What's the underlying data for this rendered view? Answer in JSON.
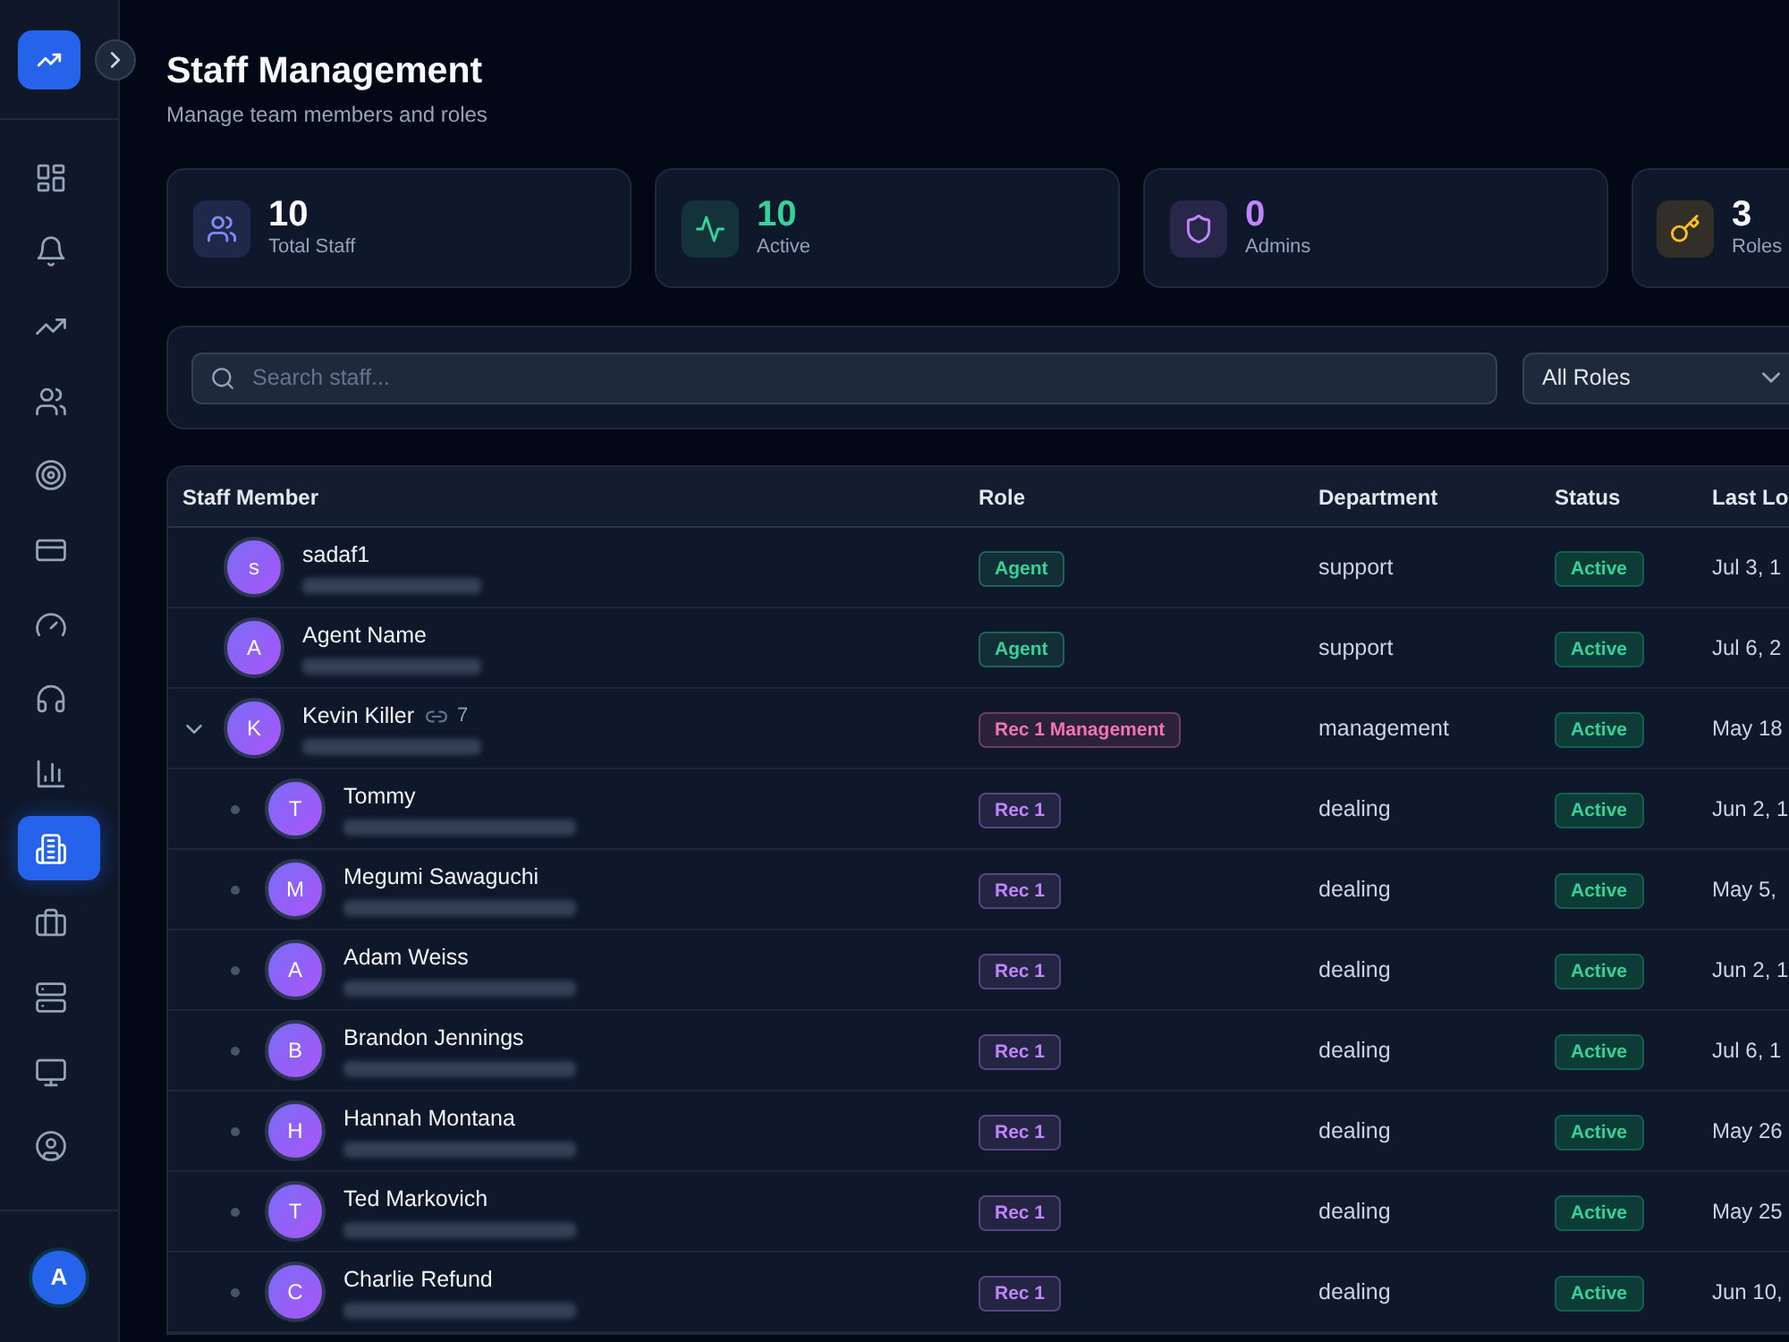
{
  "sidebar": {
    "items": [
      {
        "kind": "dashboard",
        "selected": false
      },
      {
        "kind": "bell",
        "selected": false
      },
      {
        "kind": "trending",
        "selected": false
      },
      {
        "kind": "users",
        "selected": false
      },
      {
        "kind": "target",
        "selected": false
      },
      {
        "kind": "card",
        "selected": false
      },
      {
        "kind": "gauge",
        "selected": false
      },
      {
        "kind": "headphones",
        "selected": false
      },
      {
        "kind": "chart",
        "selected": false
      },
      {
        "kind": "building",
        "selected": true
      },
      {
        "kind": "briefcase",
        "selected": false
      },
      {
        "kind": "server",
        "selected": false
      },
      {
        "kind": "monitor",
        "selected": false
      },
      {
        "kind": "profile",
        "selected": false
      }
    ],
    "user_avatar": "A"
  },
  "header": {
    "title": "Staff Management",
    "subtitle": "Manage team members and roles"
  },
  "stats": [
    {
      "kind": "staff",
      "value": "10",
      "label": "Total Staff",
      "color": "#818cf8",
      "highlight": false
    },
    {
      "kind": "activity",
      "value": "10",
      "label": "Active",
      "color": "#34d399",
      "highlight": true
    },
    {
      "kind": "admins",
      "value": "0",
      "label": "Admins",
      "color": "#c084fc",
      "highlight": true
    },
    {
      "kind": "roles",
      "value": "3",
      "label": "Roles",
      "color": "#fbbf24",
      "highlight": false
    }
  ],
  "filters": {
    "search": {
      "placeholder": "Search staff..."
    },
    "role_select": {
      "value": "All Roles"
    }
  },
  "table": {
    "columns": [
      "Staff Member",
      "Role",
      "Department",
      "Status",
      "Last Lo"
    ],
    "rows": [
      {
        "initial": "s",
        "name": "sadaf1",
        "email_blurred": true,
        "role": {
          "label": "Agent",
          "color": "#34d399"
        },
        "department": "support",
        "status": "Active",
        "last_login": "Jul 3, 1"
      },
      {
        "initial": "A",
        "name": "Agent Name",
        "email_blurred": true,
        "role": {
          "label": "Agent",
          "color": "#34d399"
        },
        "department": "support",
        "status": "Active",
        "last_login": "Jul 6, 2"
      },
      {
        "initial": "K",
        "name": "Kevin Killer",
        "linked_count": "7",
        "expanded": true,
        "email_blurred": true,
        "role": {
          "label": "Rec 1 Management",
          "color": "#f472b6"
        },
        "department": "management",
        "status": "Active",
        "last_login": "May 18",
        "children": [
          {
            "initial": "T",
            "name": "Tommy",
            "email_blurred": true,
            "role": {
              "label": "Rec 1",
              "color": "#c084fc"
            },
            "department": "dealing",
            "status": "Active",
            "last_login": "Jun 2, 1"
          },
          {
            "initial": "M",
            "name": "Megumi Sawaguchi",
            "email_blurred": true,
            "role": {
              "label": "Rec 1",
              "color": "#c084fc"
            },
            "department": "dealing",
            "status": "Active",
            "last_login": "May 5,"
          },
          {
            "initial": "A",
            "name": "Adam Weiss",
            "email_blurred": true,
            "role": {
              "label": "Rec 1",
              "color": "#c084fc"
            },
            "department": "dealing",
            "status": "Active",
            "last_login": "Jun 2, 1"
          },
          {
            "initial": "B",
            "name": "Brandon Jennings",
            "email_blurred": true,
            "role": {
              "label": "Rec 1",
              "color": "#c084fc"
            },
            "department": "dealing",
            "status": "Active",
            "last_login": "Jul 6, 1"
          },
          {
            "initial": "H",
            "name": "Hannah Montana",
            "email_blurred": true,
            "role": {
              "label": "Rec 1",
              "color": "#c084fc"
            },
            "department": "dealing",
            "status": "Active",
            "last_login": "May 26"
          },
          {
            "initial": "T",
            "name": "Ted Markovich",
            "email_blurred": true,
            "role": {
              "label": "Rec 1",
              "color": "#c084fc"
            },
            "department": "dealing",
            "status": "Active",
            "last_login": "May 25"
          },
          {
            "initial": "C",
            "name": "Charlie Refund",
            "email_blurred": true,
            "role": {
              "label": "Rec 1",
              "color": "#c084fc"
            },
            "department": "dealing",
            "status": "Active",
            "last_login": "Jun 10,"
          }
        ]
      }
    ]
  }
}
